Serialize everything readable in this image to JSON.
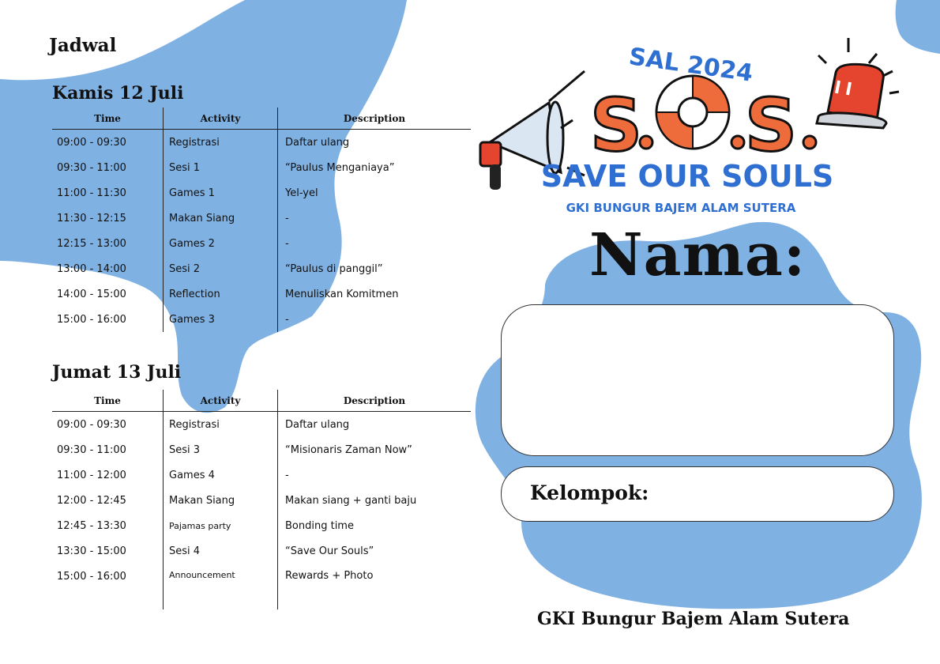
{
  "page_title": "Jadwal",
  "schedule_headers": {
    "time": "Time",
    "activity": "Activity",
    "description": "Description"
  },
  "day1": {
    "title": "Kamis 12 Juli",
    "rows": [
      {
        "time": "09:00 - 09:30",
        "activity": "Registrasi",
        "description": "Daftar ulang"
      },
      {
        "time": "09:30 - 11:00",
        "activity": "Sesi 1",
        "description": "“Paulus Menganiaya”"
      },
      {
        "time": "11:00 - 11:30",
        "activity": "Games 1",
        "description": "Yel-yel"
      },
      {
        "time": "11:30 - 12:15",
        "activity": "Makan Siang",
        "description": "-"
      },
      {
        "time": "12:15 - 13:00",
        "activity": "Games 2",
        "description": "-"
      },
      {
        "time": "13:00 - 14:00",
        "activity": "Sesi 2",
        "description": "“Paulus di panggil”"
      },
      {
        "time": "14:00 - 15:00",
        "activity": "Reflection",
        "description": "Menuliskan Komitmen"
      },
      {
        "time": "15:00 - 16:00",
        "activity": "Games 3",
        "description": "-"
      }
    ]
  },
  "day2": {
    "title": "Jumat 13 Juli",
    "rows": [
      {
        "time": "09:00 - 09:30",
        "activity": "Registrasi",
        "description": "Daftar ulang"
      },
      {
        "time": "09:30 - 11:00",
        "activity": "Sesi 3",
        "description": "“Misionaris Zaman Now”"
      },
      {
        "time": "11:00 - 12:00",
        "activity": "Games 4",
        "description": "-"
      },
      {
        "time": "12:00 - 12:45",
        "activity": "Makan Siang",
        "description": "Makan siang + ganti baju"
      },
      {
        "time": "12:45 - 13:30",
        "activity": "Pajamas party",
        "description": "Bonding time"
      },
      {
        "time": "13:30 - 15:00",
        "activity": "Sesi 4",
        "description": "“Save Our Souls”"
      },
      {
        "time": "15:00 - 16:00",
        "activity": "Announcement",
        "description": "Rewards + Photo"
      }
    ]
  },
  "logo": {
    "year_text": "SAL 2024",
    "main_text": "S.O.S.",
    "tagline": "SAVE OUR SOULS",
    "church": "GKI BUNGUR BAJEM ALAM SUTERA",
    "colors": {
      "orange": "#ee6b3b",
      "blue": "#2f6fd1",
      "siren_red": "#e5452f"
    }
  },
  "nama_label": "Nama:",
  "kelompok_label": "Kelompok:",
  "footer": "GKI Bungur Bajem Alam Sutera",
  "colors": {
    "blob_blue": "#7fb1e3"
  }
}
